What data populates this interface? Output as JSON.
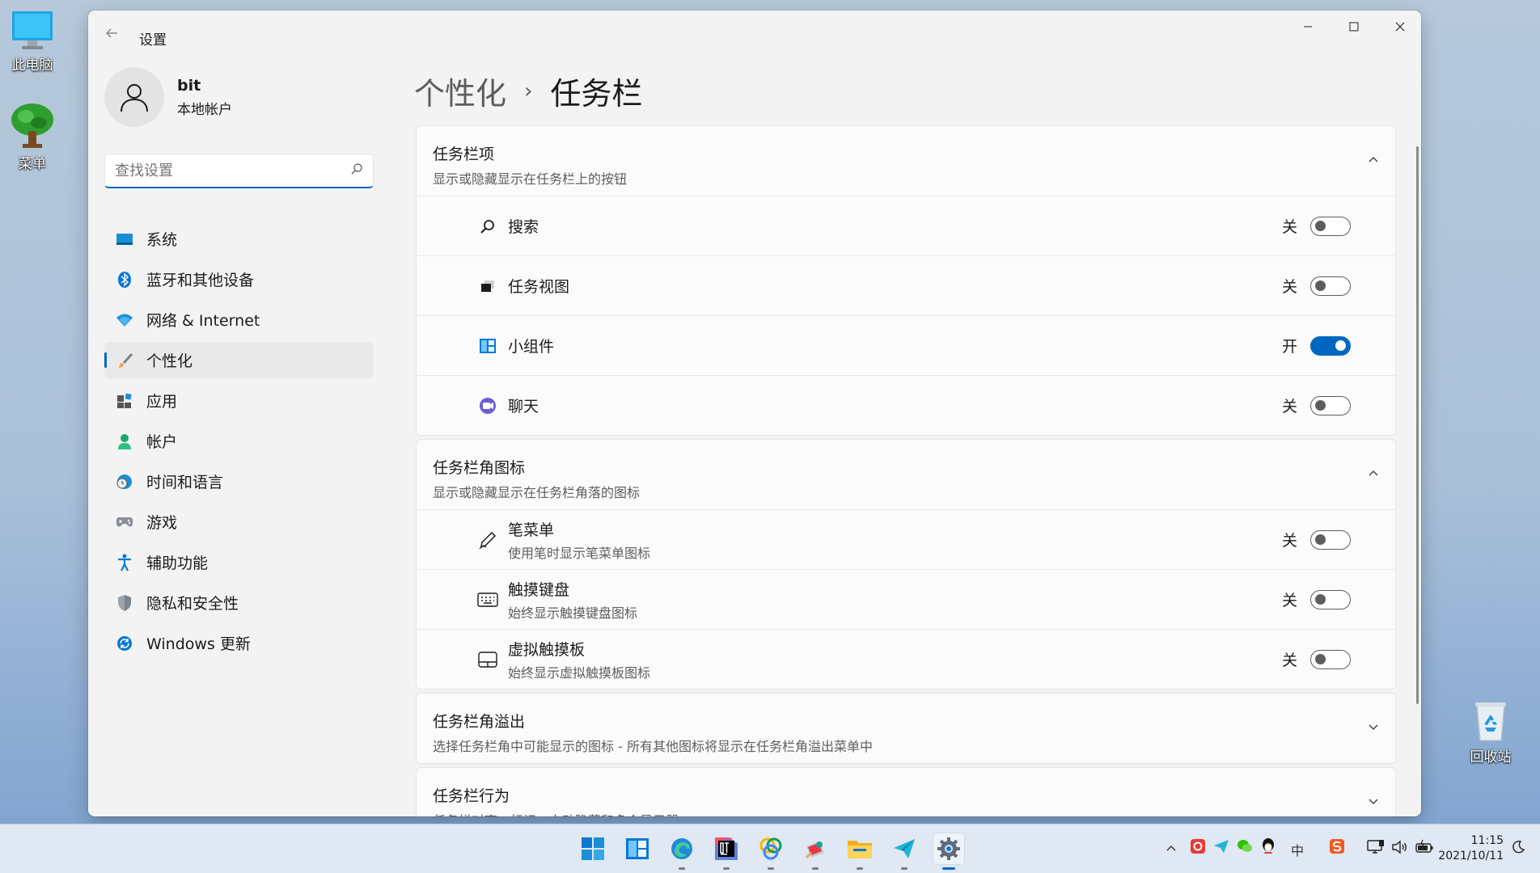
{
  "desktop": {
    "icons": [
      {
        "label": "此电脑"
      },
      {
        "label": "菜单"
      },
      {
        "label": "回收站"
      }
    ]
  },
  "window": {
    "title": "设置",
    "controls": {
      "minimize": "—",
      "maximize": "☐",
      "close": "✕"
    }
  },
  "profile": {
    "name": "bit",
    "type": "本地帐户"
  },
  "search": {
    "placeholder": "查找设置"
  },
  "nav": {
    "items": [
      {
        "label": "系统"
      },
      {
        "label": "蓝牙和其他设备"
      },
      {
        "label": "网络 & Internet"
      },
      {
        "label": "个性化",
        "active": true
      },
      {
        "label": "应用"
      },
      {
        "label": "帐户"
      },
      {
        "label": "时间和语言"
      },
      {
        "label": "游戏"
      },
      {
        "label": "辅助功能"
      },
      {
        "label": "隐私和安全性"
      },
      {
        "label": "Windows 更新"
      }
    ]
  },
  "breadcrumb": {
    "parent": "个性化",
    "separator": "›",
    "current": "任务栏"
  },
  "sections": [
    {
      "title": "任务栏项",
      "subtitle": "显示或隐藏显示在任务栏上的按钮",
      "expanded": true,
      "rows": [
        {
          "label": "搜索",
          "state": "关",
          "on": false
        },
        {
          "label": "任务视图",
          "state": "关",
          "on": false
        },
        {
          "label": "小组件",
          "state": "开",
          "on": true
        },
        {
          "label": "聊天",
          "state": "关",
          "on": false
        }
      ]
    },
    {
      "title": "任务栏角图标",
      "subtitle": "显示或隐藏显示在任务栏角落的图标",
      "expanded": true,
      "rows": [
        {
          "label": "笔菜单",
          "desc": "使用笔时显示笔菜单图标",
          "state": "关",
          "on": false
        },
        {
          "label": "触摸键盘",
          "desc": "始终显示触摸键盘图标",
          "state": "关",
          "on": false
        },
        {
          "label": "虚拟触摸板",
          "desc": "始终显示虚拟触摸板图标",
          "state": "关",
          "on": false
        }
      ]
    },
    {
      "title": "任务栏角溢出",
      "subtitle": "选择任务栏角中可能显示的图标 - 所有其他图标将显示在任务栏角溢出菜单中",
      "expanded": false
    },
    {
      "title": "任务栏行为",
      "subtitle": "任务栏对齐、标记、自动隐藏和多个显示器",
      "expanded": false
    }
  ],
  "taskbar": {
    "clock": {
      "time": "11:15",
      "date": "2021/10/11"
    },
    "tray": {
      "ime": "中"
    }
  },
  "colors": {
    "accent": "#0067c0",
    "window_bg": "#f3f3f3",
    "card_bg": "#fbfbfb"
  }
}
